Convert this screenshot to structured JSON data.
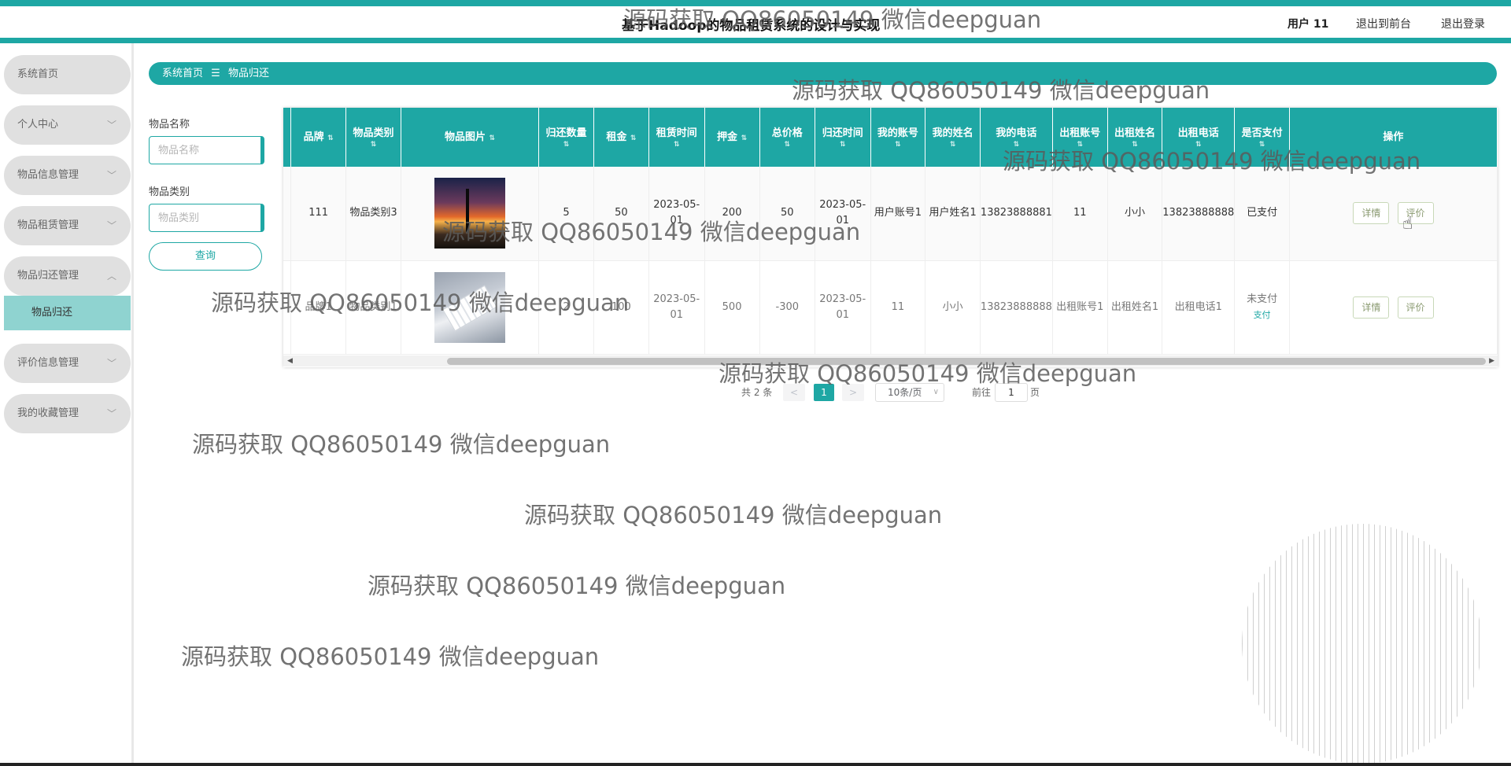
{
  "header": {
    "title": "基于Hadoop的物品租赁系统的设计与实现",
    "user_label": "用户 11",
    "back_link": "退出到前台",
    "logout_link": "退出登录"
  },
  "sidebar": {
    "items": [
      {
        "label": "系统首页"
      },
      {
        "label": "个人中心"
      },
      {
        "label": "物品信息管理"
      },
      {
        "label": "物品租赁管理"
      },
      {
        "label": "物品归还管理"
      },
      {
        "label": "评价信息管理"
      },
      {
        "label": "我的收藏管理"
      }
    ],
    "active_sub": "物品归还"
  },
  "breadcrumb": {
    "home": "系统首页",
    "sep": "☰",
    "current": "物品归还"
  },
  "search": {
    "name_label": "物品名称",
    "name_placeholder": "物品名称",
    "category_label": "物品类别",
    "category_placeholder": "物品类别",
    "query_button": "查询"
  },
  "table": {
    "headers": [
      "品牌",
      "物品类别",
      "物品图片",
      "归还数量",
      "租金",
      "租赁时间",
      "押金",
      "总价格",
      "归还时间",
      "我的账号",
      "我的姓名",
      "我的电话",
      "出租账号",
      "出租姓名",
      "出租电话",
      "是否支付",
      "操作"
    ],
    "rows": [
      {
        "brand": "111",
        "category": "物品类别3",
        "image": "sunset-tree-photo",
        "qty": "5",
        "rent": "50",
        "lease_time": "2023-05-01",
        "deposit": "200",
        "total": "50",
        "return_time": "2023-05-01",
        "my_account": "用户账号1",
        "my_name": "用户姓名1",
        "my_phone": "13823888881",
        "owner_account": "11",
        "owner_name": "小小",
        "owner_phone": "13823888888",
        "paid": "已支付",
        "pay_action": "",
        "detail_btn": "详情",
        "review_btn": "评价"
      },
      {
        "brand": "品牌1",
        "category": "物品类别1",
        "image": "keyboard-photo",
        "qty": "2",
        "rent": "100",
        "lease_time": "2023-05-01",
        "deposit": "500",
        "total": "-300",
        "return_time": "2023-05-01",
        "my_account": "11",
        "my_name": "小小",
        "my_phone": "13823888888",
        "owner_account": "出租账号1",
        "owner_name": "出租姓名1",
        "owner_phone": "出租电话1",
        "paid": "未支付",
        "pay_action": "支付",
        "detail_btn": "详情",
        "review_btn": "评价"
      }
    ]
  },
  "pagination": {
    "total": "共 2 条",
    "prev": "<",
    "current": "1",
    "next": ">",
    "page_size": "10条/页",
    "goto_label": "前往",
    "goto_value": "1",
    "page_unit": "页"
  },
  "watermark": "源码获取 QQ86050149 微信deepguan",
  "colors": {
    "primary": "#1ea7a4",
    "sub_active": "#8fd3d0",
    "menu_bg": "#e0e0e0"
  }
}
